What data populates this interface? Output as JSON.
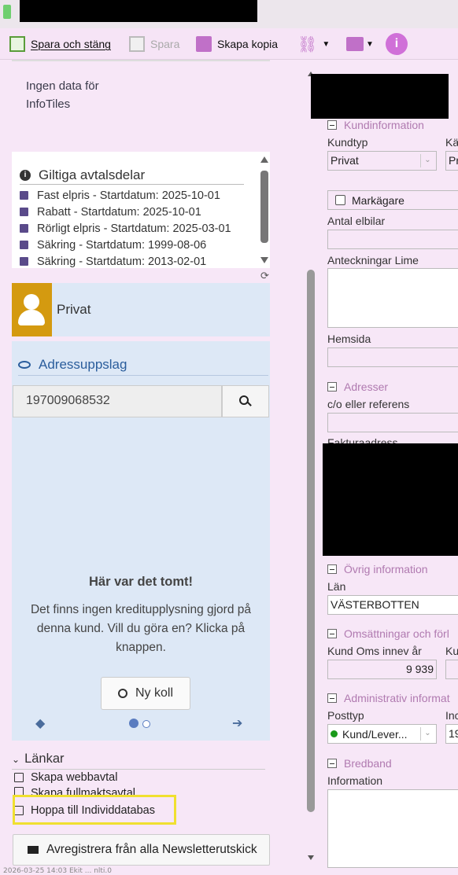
{
  "toolbar": {
    "save_close_label": "Spara och stäng",
    "save_label": "Spara",
    "copy_label": "Skapa kopia"
  },
  "infotiles": {
    "text": "Ingen data för InfoTiles"
  },
  "avtal": {
    "title": "Giltiga avtalsdelar",
    "items": [
      "Fast elpris - Startdatum: 2025-10-01",
      "Rabatt - Startdatum: 2025-10-01",
      "Rörligt elpris - Startdatum: 2025-03-01",
      "Säkring - Startdatum: 1999-08-06",
      "Säkring - Startdatum: 2013-02-01"
    ]
  },
  "customer": {
    "type_label": "Privat"
  },
  "adress": {
    "title": "Adressuppslag",
    "search_value": "197009068532",
    "empty_title": "Här var det tomt!",
    "empty_text": "Det finns ingen kreditupplysning gjord på denna kund. Vill du göra en? Klicka på knappen.",
    "button_label": "Ny koll"
  },
  "lankar": {
    "title": "Länkar",
    "items": [
      "Skapa webbavtal",
      "Skapa fullmaktsavtal",
      "Hoppa till Individdatabas"
    ]
  },
  "newsletter": {
    "label": "Avregistrera från alla Newsletterutskick"
  },
  "form": {
    "kundinformation": "Kundinformation",
    "kundtyp_label": "Kundtyp",
    "kundtyp_value": "Privat",
    "kal_label": "Kä",
    "kal_value": "Pr",
    "markagare_label": "Markägare",
    "antal_elbilar_label": "Antal elbilar",
    "anteckningar_label": "Anteckningar Lime",
    "hemsida_label": "Hemsida",
    "adresser": "Adresser",
    "co_label": "c/o eller referens",
    "fakturaadress_label": "Fakturaadress",
    "ovrig": "Övrig information",
    "lan_label": "Län",
    "lan_value": "VÄSTERBOTTEN",
    "omsattningar": "Omsättningar och förl",
    "kund_oms_label": "Kund Oms innev år",
    "ku_label": "Ku",
    "kund_oms_value": "9 939",
    "administrativ": "Administrativ informat",
    "posttyp_label": "Posttyp",
    "ind_label": "Inc",
    "posttyp_value": "Kund/Lever...",
    "ind_value": "19",
    "bredband": "Bredband",
    "information_label": "Information"
  },
  "status": {
    "footer": "2026-03-25 14:03 Ekit ... nlti.0"
  }
}
